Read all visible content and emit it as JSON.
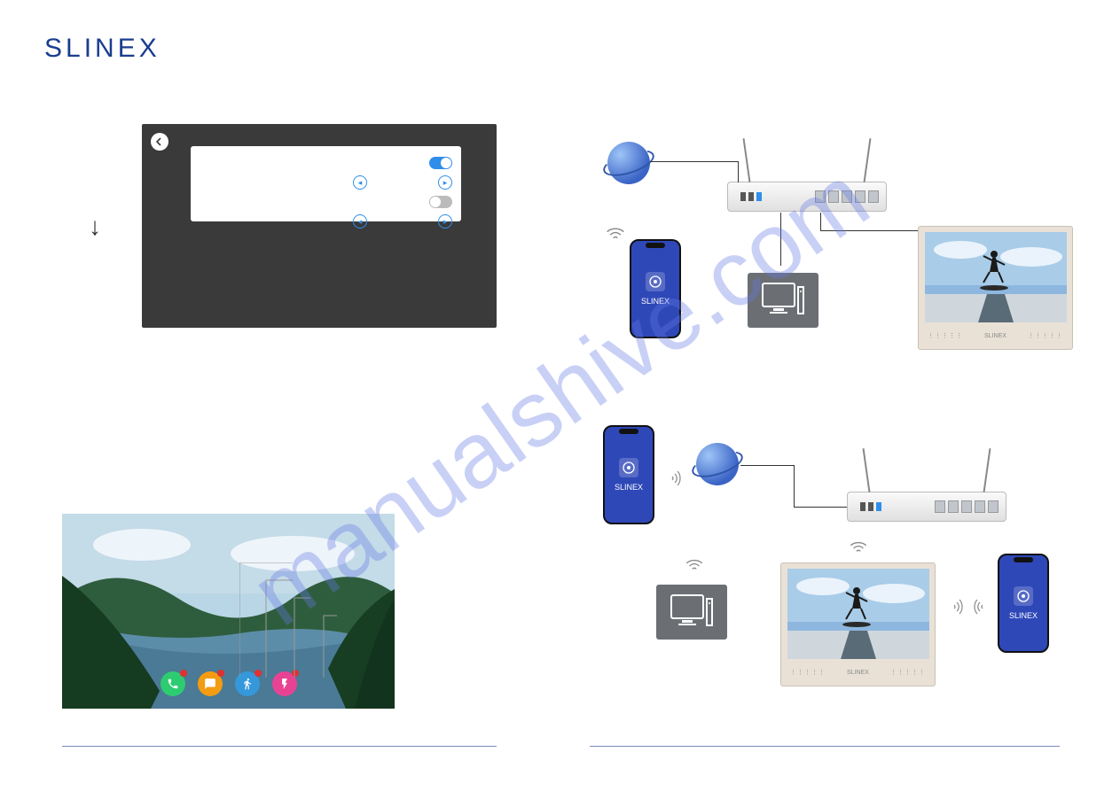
{
  "brand": "SLINEX",
  "watermark": "manualshive.com",
  "phone_app_label": "SLINEX",
  "monitor_brand": "SLINEX",
  "settings": {
    "toggle1": "on",
    "toggle2": "off"
  },
  "home_icons": [
    {
      "name": "call",
      "color": "green"
    },
    {
      "name": "message",
      "color": "orange"
    },
    {
      "name": "person",
      "color": "blue"
    },
    {
      "name": "bolt",
      "color": "pink"
    }
  ]
}
